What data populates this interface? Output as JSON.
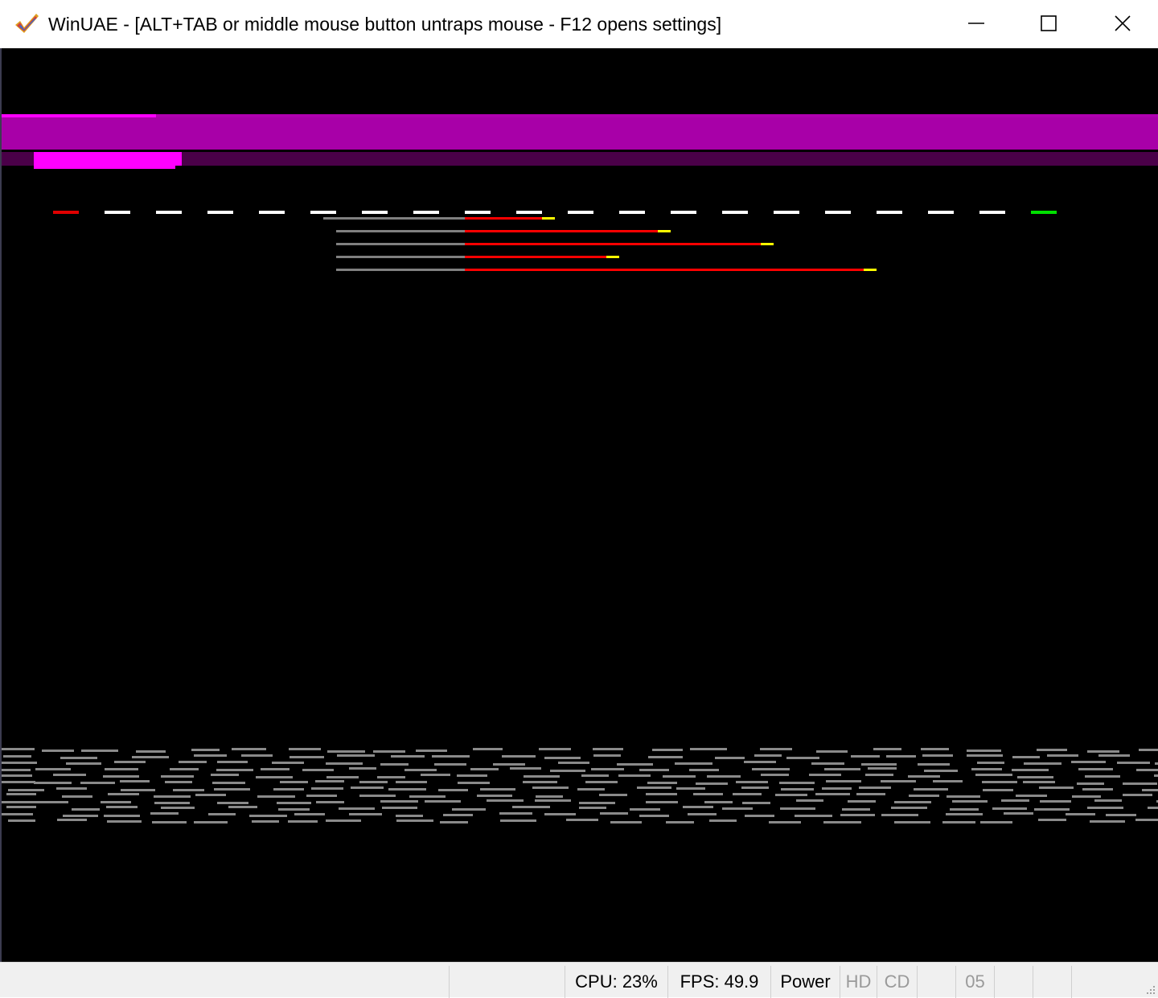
{
  "window": {
    "title": "WinUAE - [ALT+TAB or middle mouse button untraps mouse - F12 opens settings]",
    "icon": "winuae-checkmark-icon",
    "controls": [
      "minimize-icon",
      "maximize-icon",
      "close-icon"
    ]
  },
  "status_bar": {
    "cpu": "CPU: 23%",
    "fps": "FPS: 49.9",
    "power": "Power",
    "hd": "HD",
    "cd": "CD",
    "drive": "05"
  },
  "colors": {
    "magenta_band": "#a800a8",
    "magenta_bright": "#ff00ff",
    "magenta_dark": "#4a0048",
    "dash_white": "#ffffff",
    "dash_red": "#e00000",
    "dash_green": "#00e000",
    "bar_gray": "#808080",
    "bar_red": "#ff0000",
    "bar_yellow": "#ffff00",
    "stars_gray": "#8a8a8a"
  }
}
